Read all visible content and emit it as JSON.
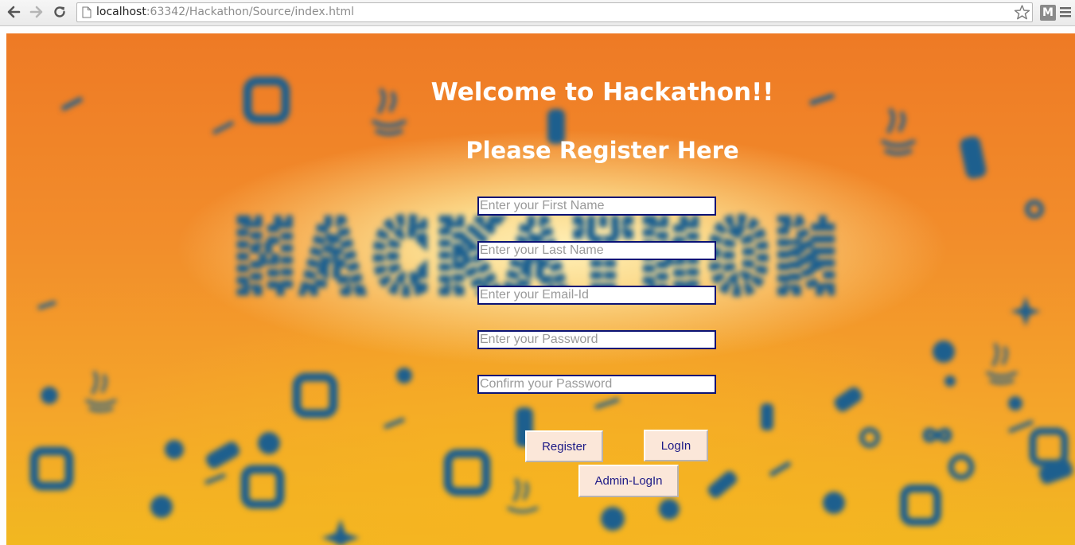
{
  "browser": {
    "url_host": "localhost",
    "url_rest": ":63342/Hackathon/Source/index.html",
    "extension_label": "M"
  },
  "page": {
    "background_logo_text": "HACKATHON",
    "welcome_heading": "Welcome to Hackathon!!",
    "register_heading": "Please Register Here",
    "fields": {
      "first_name": {
        "placeholder": "Enter your First Name",
        "value": ""
      },
      "last_name": {
        "placeholder": "Enter your Last Name",
        "value": ""
      },
      "email": {
        "placeholder": "Enter your Email-Id",
        "value": ""
      },
      "password": {
        "placeholder": "Enter your Password",
        "value": ""
      },
      "confirm_password": {
        "placeholder": "Confirm your Password",
        "value": ""
      }
    },
    "buttons": {
      "register": "Register",
      "login": "LogIn",
      "admin_login": "Admin-LogIn"
    }
  },
  "colors": {
    "heading": "#ffffff",
    "field_border": "#0a1275",
    "button_bg": "#fbe7d9",
    "button_text": "#1d1a86",
    "art_blue": "#1d5f8e",
    "bg_orange": "#ee7a25",
    "bg_yellow": "#f2b820"
  }
}
